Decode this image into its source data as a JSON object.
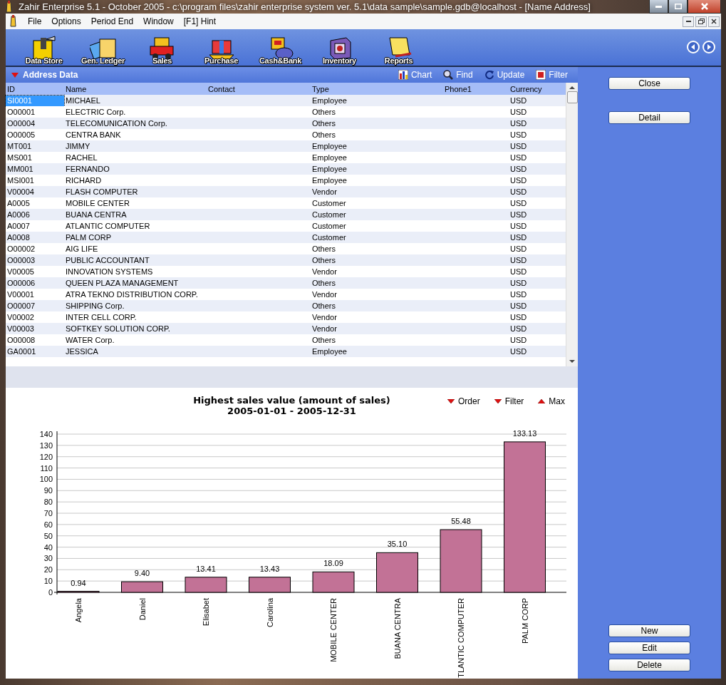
{
  "window": {
    "title": "Zahir Enterprise 5.1 - October 2005 - c:\\program files\\zahir enterprise system ver. 5.1\\data sample\\sample.gdb@localhost - [Name Address]"
  },
  "menu": [
    "File",
    "Options",
    "Period End",
    "Window",
    "[F1] Hint"
  ],
  "toolbar": [
    "Data Store",
    "Gen. Ledger",
    "Sales",
    "Purchase",
    "Cash&Bank",
    "Inventory",
    "Reports"
  ],
  "panel": {
    "title": "Address Data",
    "expanded": true,
    "actions": [
      "Chart",
      "Find",
      "Update",
      "Filter"
    ]
  },
  "table": {
    "columns": [
      "ID",
      "Name",
      "Contact",
      "Type",
      "Phone1",
      "Currency"
    ],
    "rows": [
      {
        "cells": [
          "SI0001",
          "MICHAEL",
          "",
          "Employee",
          "",
          "USD"
        ],
        "selected": true
      },
      {
        "cells": [
          "O00001",
          "ELECTRIC Corp.",
          "",
          "Others",
          "",
          "USD"
        ],
        "selected": false
      },
      {
        "cells": [
          "O00004",
          "TELECOMUNICATION Corp.",
          "",
          "Others",
          "",
          "USD"
        ],
        "selected": false
      },
      {
        "cells": [
          "O00005",
          "CENTRA BANK",
          "",
          "Others",
          "",
          "USD"
        ],
        "selected": false
      },
      {
        "cells": [
          "MT001",
          "JIMMY",
          "",
          "Employee",
          "",
          "USD"
        ],
        "selected": false
      },
      {
        "cells": [
          "MS001",
          "RACHEL",
          "",
          "Employee",
          "",
          "USD"
        ],
        "selected": false
      },
      {
        "cells": [
          "MM001",
          "FERNANDO",
          "",
          "Employee",
          "",
          "USD"
        ],
        "selected": false
      },
      {
        "cells": [
          "MSI001",
          "RICHARD",
          "",
          "Employee",
          "",
          "USD"
        ],
        "selected": false
      },
      {
        "cells": [
          "V00004",
          "FLASH COMPUTER",
          "",
          "Vendor",
          "",
          "USD"
        ],
        "selected": false
      },
      {
        "cells": [
          "A0005",
          "MOBILE CENTER",
          "",
          "Customer",
          "",
          "USD"
        ],
        "selected": false
      },
      {
        "cells": [
          "A0006",
          "BUANA CENTRA",
          "",
          "Customer",
          "",
          "USD"
        ],
        "selected": false
      },
      {
        "cells": [
          "A0007",
          "ATLANTIC COMPUTER",
          "",
          "Customer",
          "",
          "USD"
        ],
        "selected": false
      },
      {
        "cells": [
          "A0008",
          "PALM CORP",
          "",
          "Customer",
          "",
          "USD"
        ],
        "selected": false
      },
      {
        "cells": [
          "O00002",
          "AIG LIFE",
          "",
          "Others",
          "",
          "USD"
        ],
        "selected": false
      },
      {
        "cells": [
          "O00003",
          "PUBLIC ACCOUNTANT",
          "",
          "Others",
          "",
          "USD"
        ],
        "selected": false
      },
      {
        "cells": [
          "V00005",
          "INNOVATION SYSTEMS",
          "",
          "Vendor",
          "",
          "USD"
        ],
        "selected": false
      },
      {
        "cells": [
          "O00006",
          "QUEEN PLAZA MANAGEMENT",
          "",
          "Others",
          "",
          "USD"
        ],
        "selected": false
      },
      {
        "cells": [
          "V00001",
          "ATRA TEKNO DISTRIBUTION CORP.",
          "",
          "Vendor",
          "",
          "USD"
        ],
        "selected": false
      },
      {
        "cells": [
          "O00007",
          "SHIPPING Corp.",
          "",
          "Others",
          "",
          "USD"
        ],
        "selected": false
      },
      {
        "cells": [
          "V00002",
          "INTER CELL CORP.",
          "",
          "Vendor",
          "",
          "USD"
        ],
        "selected": false
      },
      {
        "cells": [
          "V00003",
          "SOFTKEY SOLUTION CORP.",
          "",
          "Vendor",
          "",
          "USD"
        ],
        "selected": false
      },
      {
        "cells": [
          "O00008",
          "WATER Corp.",
          "",
          "Others",
          "",
          "USD"
        ],
        "selected": false
      },
      {
        "cells": [
          "GA0001",
          "JESSICA",
          "",
          "Employee",
          "",
          "USD"
        ],
        "selected": false
      }
    ]
  },
  "chart": {
    "title": "Highest sales value (amount of sales)",
    "period": "2005-01-01 - 2005-12-31",
    "controls": [
      {
        "label": "Order",
        "kind": "down"
      },
      {
        "label": "Filter",
        "kind": "down"
      },
      {
        "label": "Max",
        "kind": "up"
      }
    ],
    "chart_data": {
      "type": "bar",
      "categories": [
        "Angela",
        "Daniel",
        "Elisabet",
        "Carolina",
        "MOBILE CENTER",
        "BUANA CENTRA",
        "TLANTIC COMPUTER",
        "PALM CORP"
      ],
      "series": [
        {
          "color": "#c27296",
          "values": [
            0.94,
            9.4,
            13.41,
            13.43,
            18.09,
            35.1,
            55.48,
            133.13
          ]
        }
      ],
      "ylim": [
        0,
        140
      ],
      "yticks": [
        0,
        10,
        20,
        30,
        40,
        50,
        60,
        70,
        80,
        90,
        100,
        110,
        120,
        130,
        140
      ],
      "grid": true,
      "value_labels": [
        "0.94",
        "9.40",
        "13.41",
        "13.43",
        "18.09",
        "35.10",
        "55.48",
        "133.13"
      ]
    }
  },
  "side_buttons_top": [
    "Close",
    "Detail"
  ],
  "side_buttons_bottom": [
    "New",
    "Edit",
    "Delete"
  ]
}
